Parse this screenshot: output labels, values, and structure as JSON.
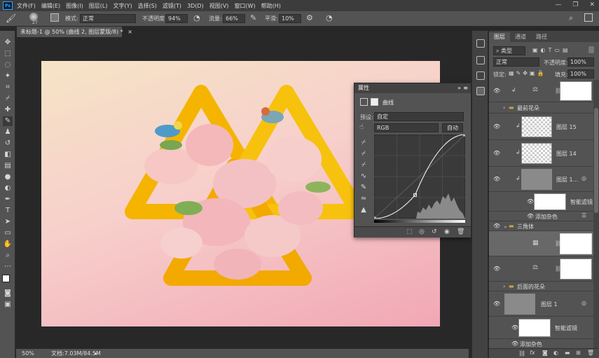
{
  "app": {
    "logo": "Ps",
    "window_controls": [
      "—",
      "❐",
      "✕"
    ]
  },
  "menu": [
    "文件(F)",
    "编辑(E)",
    "图像(I)",
    "图层(L)",
    "文字(Y)",
    "选择(S)",
    "滤镜(T)",
    "3D(D)",
    "视图(V)",
    "窗口(W)",
    "帮助(H)"
  ],
  "options": {
    "brush_size": "27",
    "mode_label": "模式:",
    "mode_value": "正常",
    "opacity_label": "不透明度:",
    "opacity_value": "94%",
    "flow_label": "流量:",
    "flow_value": "66%",
    "smooth_label": "平滑:",
    "smooth_value": "10%"
  },
  "document": {
    "tab_title": "未标题-1 @ 50% (曲线 2, 图层蒙版/8) *",
    "tab_close": "×"
  },
  "status": {
    "zoom": "50%",
    "doc_info": "文档:7.03M/84.5M"
  },
  "properties": {
    "title": "属性",
    "adjustment": "曲线",
    "preset_label": "预设:",
    "preset_value": "自定",
    "channel": "RGB",
    "auto_label": "自动",
    "curve": {
      "points": [
        [
          0,
          0
        ],
        [
          0.45,
          0.28
        ],
        [
          1,
          1
        ]
      ]
    },
    "colors": {
      "accent": "#31a8ff"
    }
  },
  "layers_panel": {
    "tabs": [
      "图层",
      "通道",
      "路径"
    ],
    "filter_label": "类型",
    "blend_mode": "正常",
    "opacity_label": "不透明度:",
    "opacity_value": "100%",
    "lock_label": "锁定:",
    "fill_label": "填充:",
    "fill_value": "100%",
    "rows": [
      {
        "name": "",
        "kind": "adjustment-levels"
      },
      {
        "name": "最前花朵",
        "kind": "group"
      },
      {
        "name": "图层 15",
        "kind": "layer"
      },
      {
        "name": "图层 14",
        "kind": "layer"
      },
      {
        "name": "图层 1...",
        "kind": "smart"
      },
      {
        "name": "智能滤镜",
        "kind": "filter"
      },
      {
        "name": "添加杂色",
        "kind": "filter-item"
      },
      {
        "name": "三角体",
        "kind": "group"
      },
      {
        "name": "",
        "kind": "adjustment-curves"
      },
      {
        "name": "",
        "kind": "adjustment-levels"
      },
      {
        "name": "后面的花朵",
        "kind": "group"
      },
      {
        "name": "图层 1",
        "kind": "smart"
      },
      {
        "name": "智能滤镜",
        "kind": "filter"
      },
      {
        "name": "添加杂色",
        "kind": "filter-item"
      }
    ],
    "footer_icons": [
      "link-icon",
      "fx-icon",
      "mask-icon",
      "adjustment-icon",
      "group-icon",
      "new-layer-icon",
      "trash-icon"
    ]
  }
}
